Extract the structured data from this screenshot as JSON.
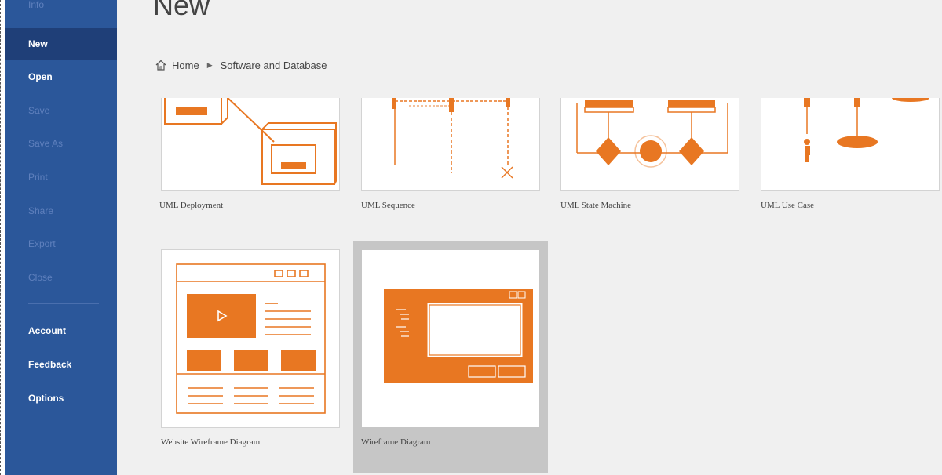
{
  "sidebar": {
    "items": [
      {
        "label": "Info",
        "state": "disabled"
      },
      {
        "label": "New",
        "state": "selected"
      },
      {
        "label": "Open",
        "state": "normal"
      },
      {
        "label": "Save",
        "state": "disabled"
      },
      {
        "label": "Save As",
        "state": "disabled"
      },
      {
        "label": "Print",
        "state": "disabled"
      },
      {
        "label": "Share",
        "state": "disabled"
      },
      {
        "label": "Export",
        "state": "disabled"
      },
      {
        "label": "Close",
        "state": "disabled"
      },
      {
        "label": "Account",
        "state": "normal"
      },
      {
        "label": "Feedback",
        "state": "normal"
      },
      {
        "label": "Options",
        "state": "normal"
      }
    ]
  },
  "main": {
    "title": "New",
    "breadcrumb": {
      "home": "Home",
      "current": "Software and Database"
    },
    "templates": [
      {
        "label": "UML Deployment",
        "icon": "uml-deployment-icon"
      },
      {
        "label": "UML Sequence",
        "icon": "uml-sequence-icon"
      },
      {
        "label": "UML State Machine",
        "icon": "uml-state-machine-icon"
      },
      {
        "label": "UML Use Case",
        "icon": "uml-use-case-icon"
      },
      {
        "label": "Website Wireframe Diagram",
        "icon": "website-wireframe-icon"
      },
      {
        "label": "Wireframe Diagram",
        "icon": "wireframe-icon",
        "selected": true
      }
    ]
  },
  "colors": {
    "sidebar": "#2b579a",
    "sidebar_selected": "#1f3f78",
    "accent": "#e87722",
    "background": "#f0f0f0"
  }
}
